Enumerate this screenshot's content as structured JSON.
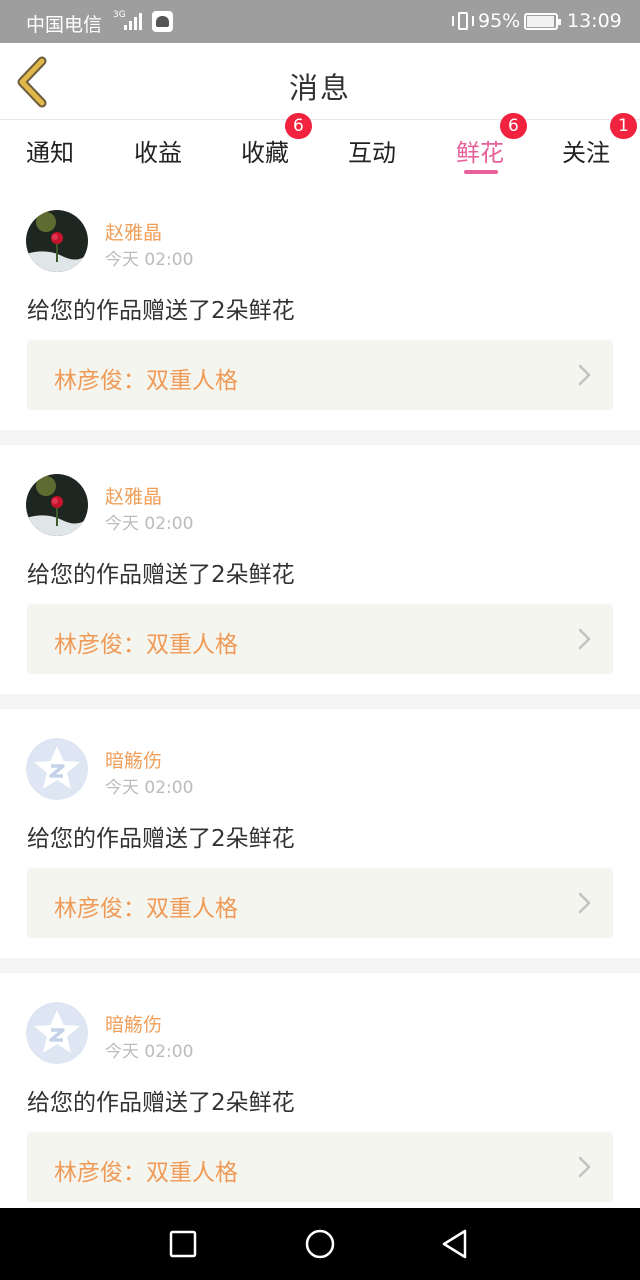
{
  "status_bar": {
    "carrier": "中国电信",
    "network": "3G",
    "battery": "95%",
    "time": "13:09"
  },
  "header": {
    "title": "消息",
    "back_icon": "chevron-left-icon"
  },
  "tabs": [
    {
      "label": "通知",
      "badge": ""
    },
    {
      "label": "收益",
      "badge": ""
    },
    {
      "label": "收藏",
      "badge": "6"
    },
    {
      "label": "互动",
      "badge": ""
    },
    {
      "label": "鲜花",
      "badge": "6",
      "active": true
    },
    {
      "label": "关注",
      "badge": "1"
    }
  ],
  "messages": [
    {
      "sender": "赵雅晶",
      "time": "今天 02:00",
      "text": "给您的作品赠送了2朵鲜花",
      "work": "林彦俊：双重人格",
      "avatar": "rose-photo"
    },
    {
      "sender": "赵雅晶",
      "time": "今天 02:00",
      "text": "给您的作品赠送了2朵鲜花",
      "work": "林彦俊：双重人格",
      "avatar": "rose-photo"
    },
    {
      "sender": "暗觞伤",
      "time": "今天 02:00",
      "text": "给您的作品赠送了2朵鲜花",
      "work": "林彦俊：双重人格",
      "avatar": "default-star"
    },
    {
      "sender": "暗觞伤",
      "time": "今天 02:00",
      "text": "给您的作品赠送了2朵鲜花",
      "work": "林彦俊：双重人格",
      "avatar": "default-star"
    }
  ],
  "colors": {
    "accent": "#e8609a",
    "badge": "#f2233f",
    "sender": "#f0a05a",
    "work_text": "#f09a57",
    "back_arrow": "#e0b84a"
  },
  "nav_bar": {
    "icons": [
      "square-icon",
      "circle-icon",
      "triangle-back-icon"
    ]
  }
}
